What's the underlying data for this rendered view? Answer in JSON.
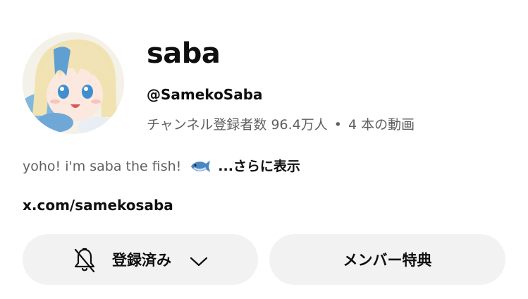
{
  "channel": {
    "name": "saba",
    "handle": "@SamekoSaba",
    "subscribers": "チャンネル登録者数 96.4万人",
    "separator": "•",
    "videos": "4 本の動画"
  },
  "description": {
    "text": "yoho! i'm saba the fish!",
    "emoji_icon": "fish-icon",
    "more_label": "...さらに表示"
  },
  "link": {
    "text": "x.com/samekosaba"
  },
  "buttons": {
    "subscribed_label": "登録済み",
    "member_label": "メンバー特典"
  },
  "icons": {
    "bell": "bell-off-icon",
    "chevron": "chevron-down-icon"
  },
  "colors": {
    "background": "#ffffff",
    "text_primary": "#0f0f0f",
    "text_secondary": "#606060",
    "button_background": "#f2f2f2"
  }
}
